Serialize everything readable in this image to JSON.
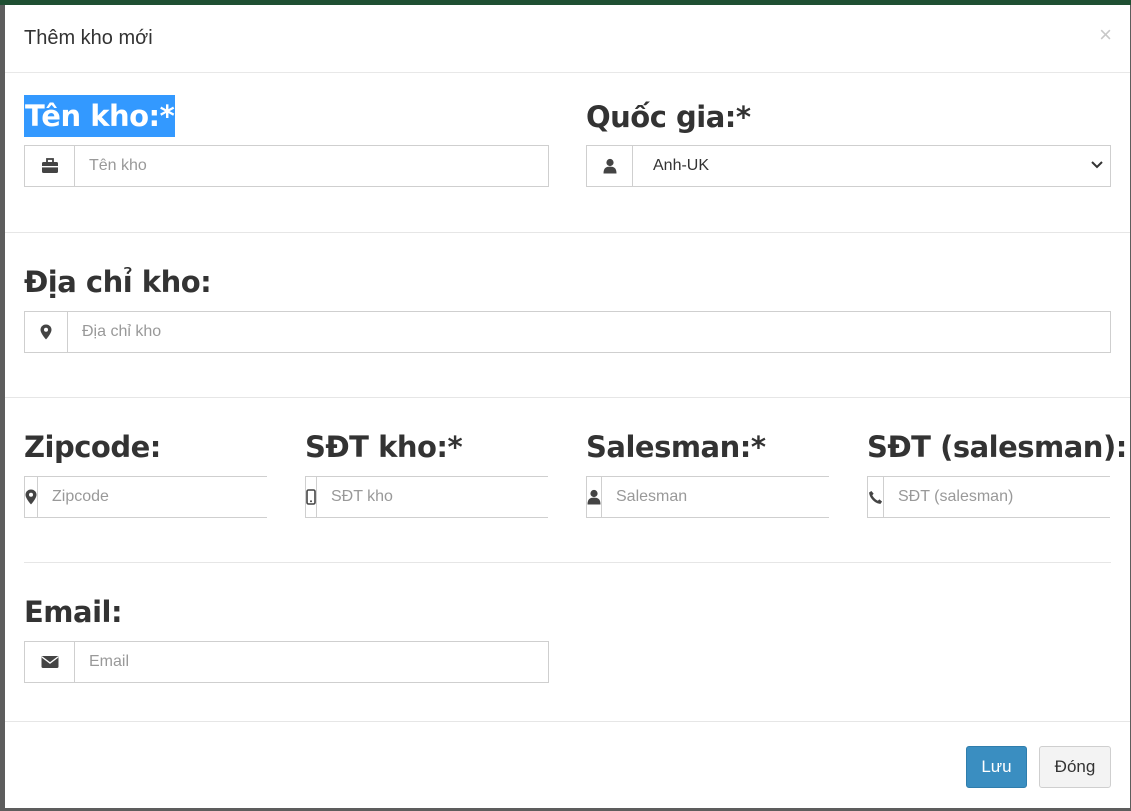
{
  "modal": {
    "title": "Thêm kho mới",
    "close_glyph": "×"
  },
  "fields": {
    "warehouse_name": {
      "label": "Tên kho:*",
      "placeholder": "Tên kho",
      "icon": "briefcase-icon"
    },
    "country": {
      "label": "Quốc gia:*",
      "value": "Anh-UK",
      "icon": "user-icon"
    },
    "address": {
      "label": "Địa chỉ kho:",
      "placeholder": "Địa chỉ kho",
      "icon": "map-marker-icon"
    },
    "zipcode": {
      "label": "Zipcode:",
      "placeholder": "Zipcode",
      "icon": "map-marker-icon"
    },
    "warehouse_phone": {
      "label": "SĐT kho:*",
      "placeholder": "SĐT kho",
      "icon": "mobile-icon"
    },
    "salesman": {
      "label": "Salesman:*",
      "placeholder": "Salesman",
      "icon": "user-icon"
    },
    "salesman_phone": {
      "label": "SĐT (salesman):",
      "placeholder": "SĐT (salesman)",
      "icon": "phone-icon"
    },
    "email": {
      "label": "Email:",
      "placeholder": "Email",
      "icon": "envelope-icon"
    }
  },
  "footer": {
    "save_label": "Lưu",
    "close_label": "Đóng"
  },
  "colors": {
    "primary": "#3a8ec1",
    "selection_highlight": "#3399ff"
  }
}
